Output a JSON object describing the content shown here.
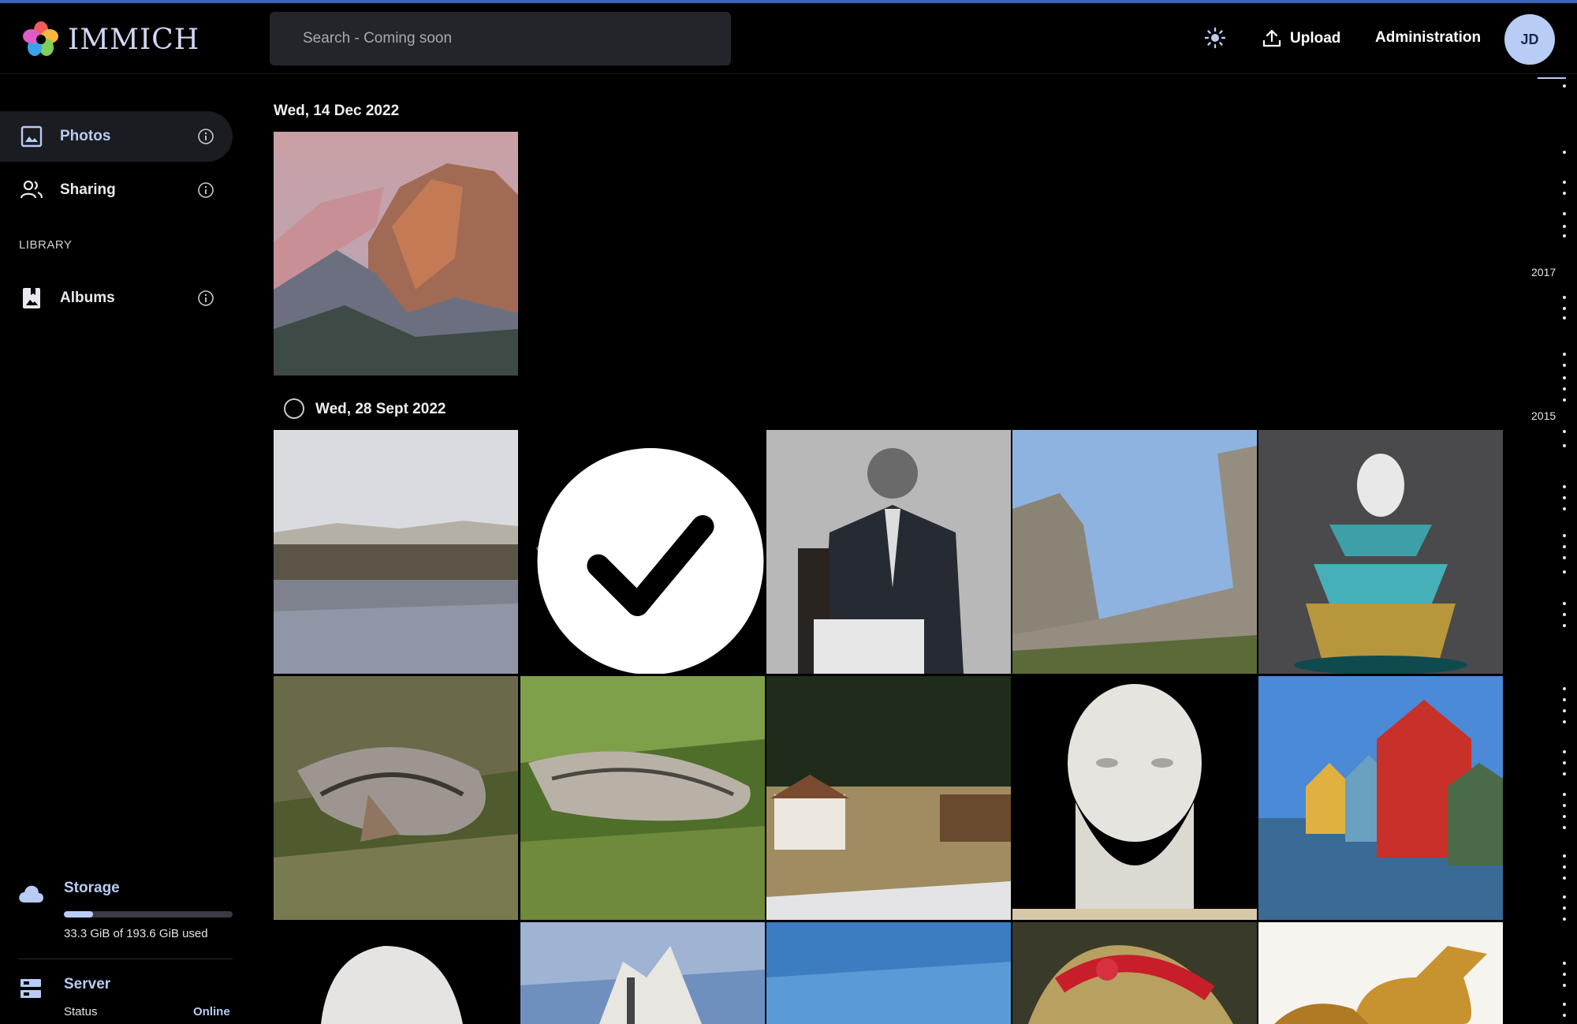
{
  "app": {
    "name": "IMMICH"
  },
  "header": {
    "search_placeholder": "Search - Coming soon",
    "upload_label": "Upload",
    "admin_label": "Administration",
    "avatar_initials": "JD"
  },
  "sidebar": {
    "items": [
      {
        "label": "Photos",
        "icon": "photos-icon",
        "active": true
      },
      {
        "label": "Sharing",
        "icon": "sharing-icon",
        "active": false
      }
    ],
    "library_label": "LIBRARY",
    "library_items": [
      {
        "label": "Albums",
        "icon": "albums-icon"
      }
    ],
    "storage": {
      "title": "Storage",
      "used_text": "33.3 GiB of 193.6 GiB used",
      "used_fraction": 0.172
    },
    "server": {
      "title": "Server",
      "status_label": "Status",
      "status_value": "Online"
    }
  },
  "timeline": {
    "groups": [
      {
        "date": "Wed, 14 Dec 2022"
      },
      {
        "date": "Wed, 28 Sept 2022"
      }
    ],
    "years": [
      "2017",
      "2015"
    ]
  },
  "colors": {
    "accent": "#b8cdf6",
    "top_line": "#3f63b8",
    "sidebar_active": "#1b1c22",
    "search_bg": "#24252b"
  }
}
